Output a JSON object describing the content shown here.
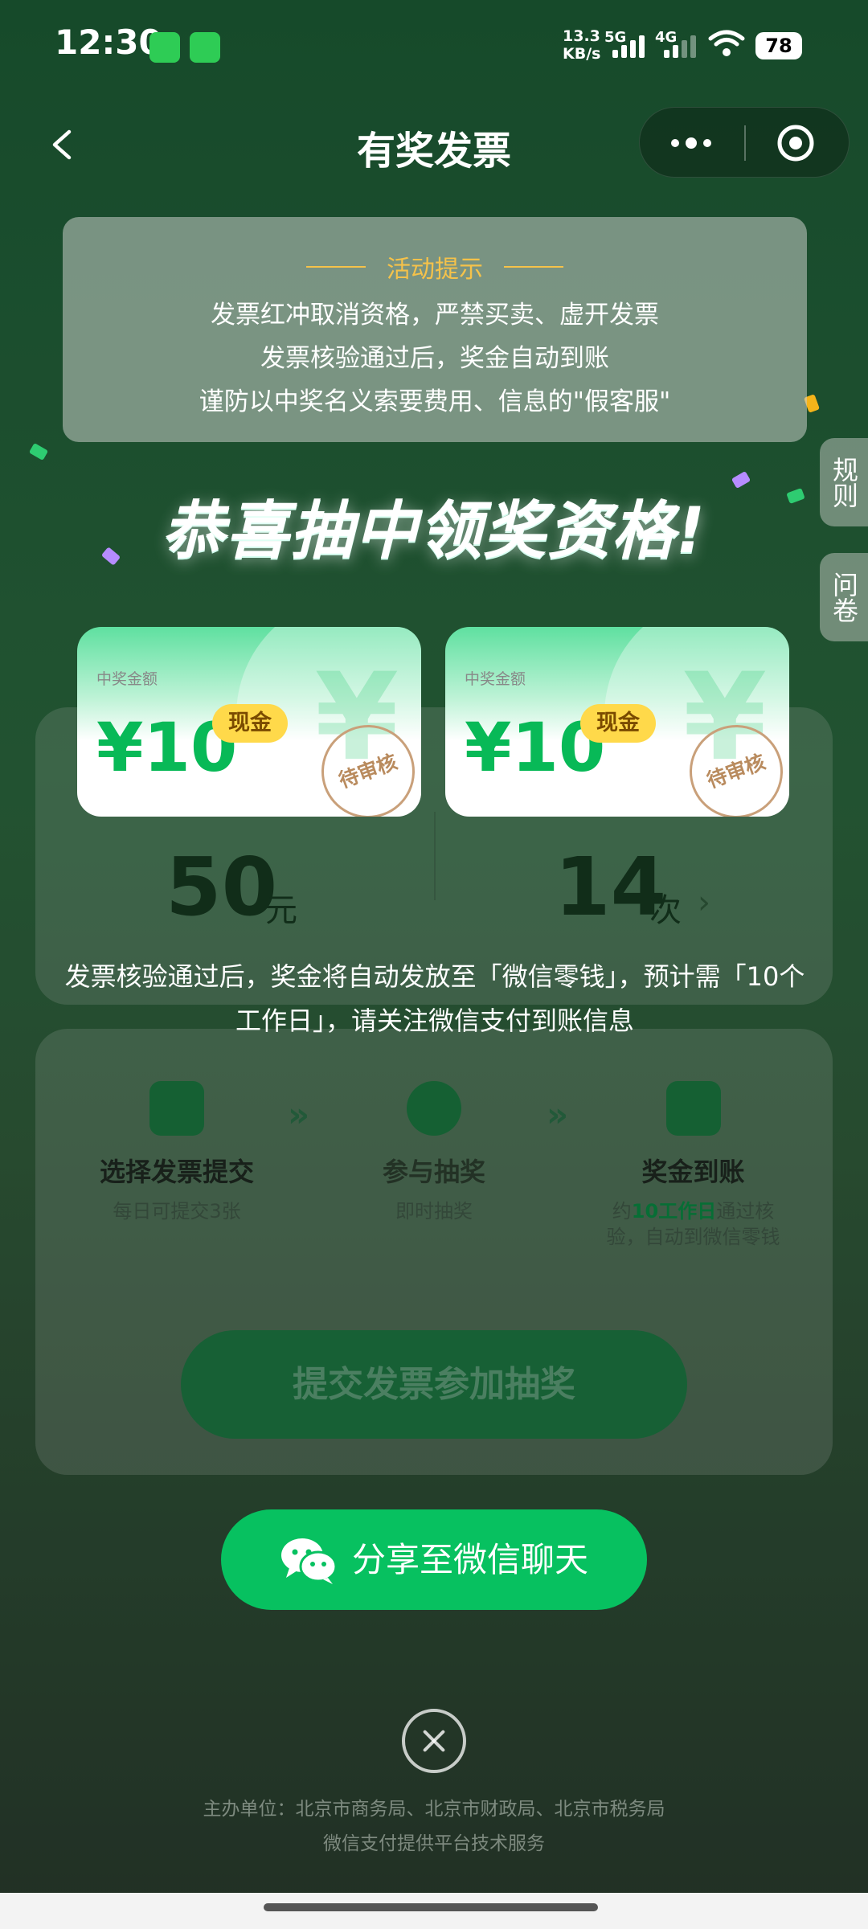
{
  "status_bar": {
    "time": "12:30",
    "network_speed_top": "13.3",
    "network_speed_bottom": "KB/s",
    "sim1": "5G",
    "sim2": "4G",
    "battery": "78"
  },
  "header": {
    "title": "有奖发票"
  },
  "notice": {
    "title": "活动提示",
    "lines": [
      "发票红冲取消资格，严禁买卖、虚开发票",
      "发票核验通过后，奖金自动到账",
      "谨防以中奖名义索要费用、信息的\"假客服\""
    ]
  },
  "side_tabs": [
    "规则",
    "问卷"
  ],
  "congrats": "恭喜抽中领奖资格!",
  "prizes": [
    {
      "label": "中奖金额",
      "amount": "¥10",
      "tag": "现金",
      "stamp": "待审核"
    },
    {
      "label": "中奖金额",
      "amount": "¥10",
      "tag": "现金",
      "stamp": "待审核"
    }
  ],
  "stats": {
    "amount_value": "50",
    "amount_unit": "元",
    "count_value": "14",
    "count_unit": "次"
  },
  "explanation": "发票核验通过后，奖金将自动发放至「微信零钱」，预计需「10个工作日」，请关注微信支付到账信息",
  "steps": [
    {
      "title": "选择发票提交",
      "sub": "每日可提交3张"
    },
    {
      "title": "参与抽奖",
      "sub": "即时抽奖"
    },
    {
      "title": "奖金到账",
      "sub_pre": "约",
      "sub_highlight": "10工作日",
      "sub_post": "通过核验，自动到微信零钱"
    }
  ],
  "submit_button": "提交发票参加抽奖",
  "share_button": "分享至微信聊天",
  "footer": {
    "line1": "主办单位：北京市商务局、北京市财政局、北京市税务局",
    "line2": "微信支付提供平台技术服务"
  },
  "colors": {
    "brand_green": "#07c160",
    "amount_green": "#08b957",
    "tag_yellow": "#ffd94a",
    "notice_gold": "#f5c24a"
  }
}
